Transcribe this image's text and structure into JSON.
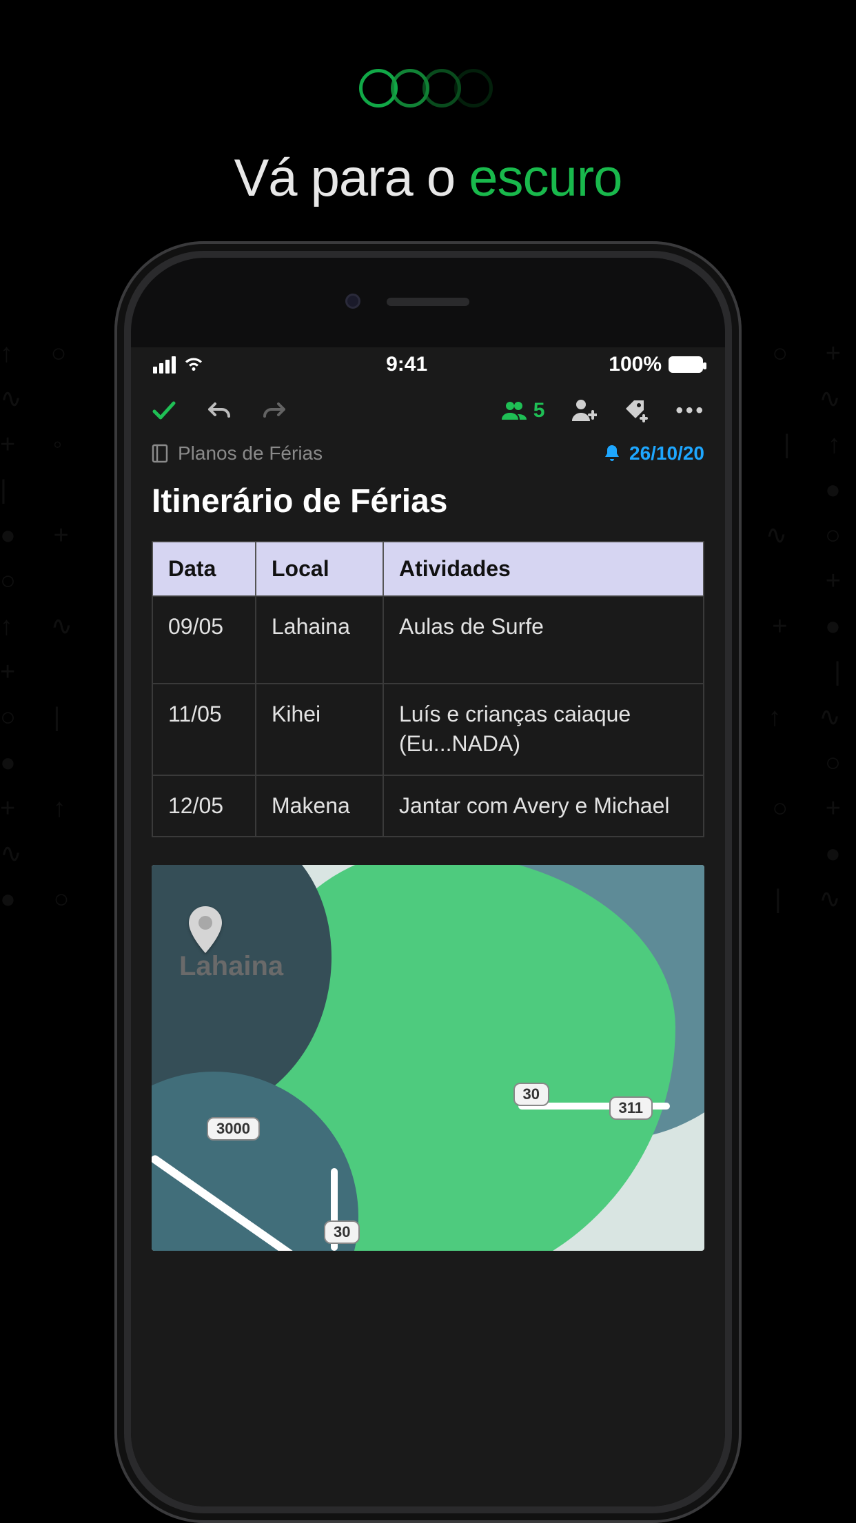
{
  "hero": {
    "tagline_plain": "Vá para o ",
    "tagline_accent": "escuro"
  },
  "status": {
    "time": "9:41",
    "battery": "100%"
  },
  "toolbar": {
    "share_count": "5"
  },
  "crumb": {
    "notebook": "Planos de Férias",
    "reminder_date": "26/10/20"
  },
  "note": {
    "title": "Itinerário de Férias"
  },
  "table": {
    "headers": {
      "date": "Data",
      "place": "Local",
      "activity": "Atividades"
    },
    "rows": [
      {
        "date": "09/05",
        "place": "Lahaina",
        "activity": "Aulas de Surfe"
      },
      {
        "date": "11/05",
        "place": "Kihei",
        "activity": "Luís e crianças caiaque (Eu...NADA)"
      },
      {
        "date": "12/05",
        "place": "Makena",
        "activity": "Jantar com Avery e Michael"
      }
    ]
  },
  "map": {
    "pin_label": "Lahaina",
    "roads": [
      "3000",
      "30",
      "311",
      "30"
    ]
  }
}
